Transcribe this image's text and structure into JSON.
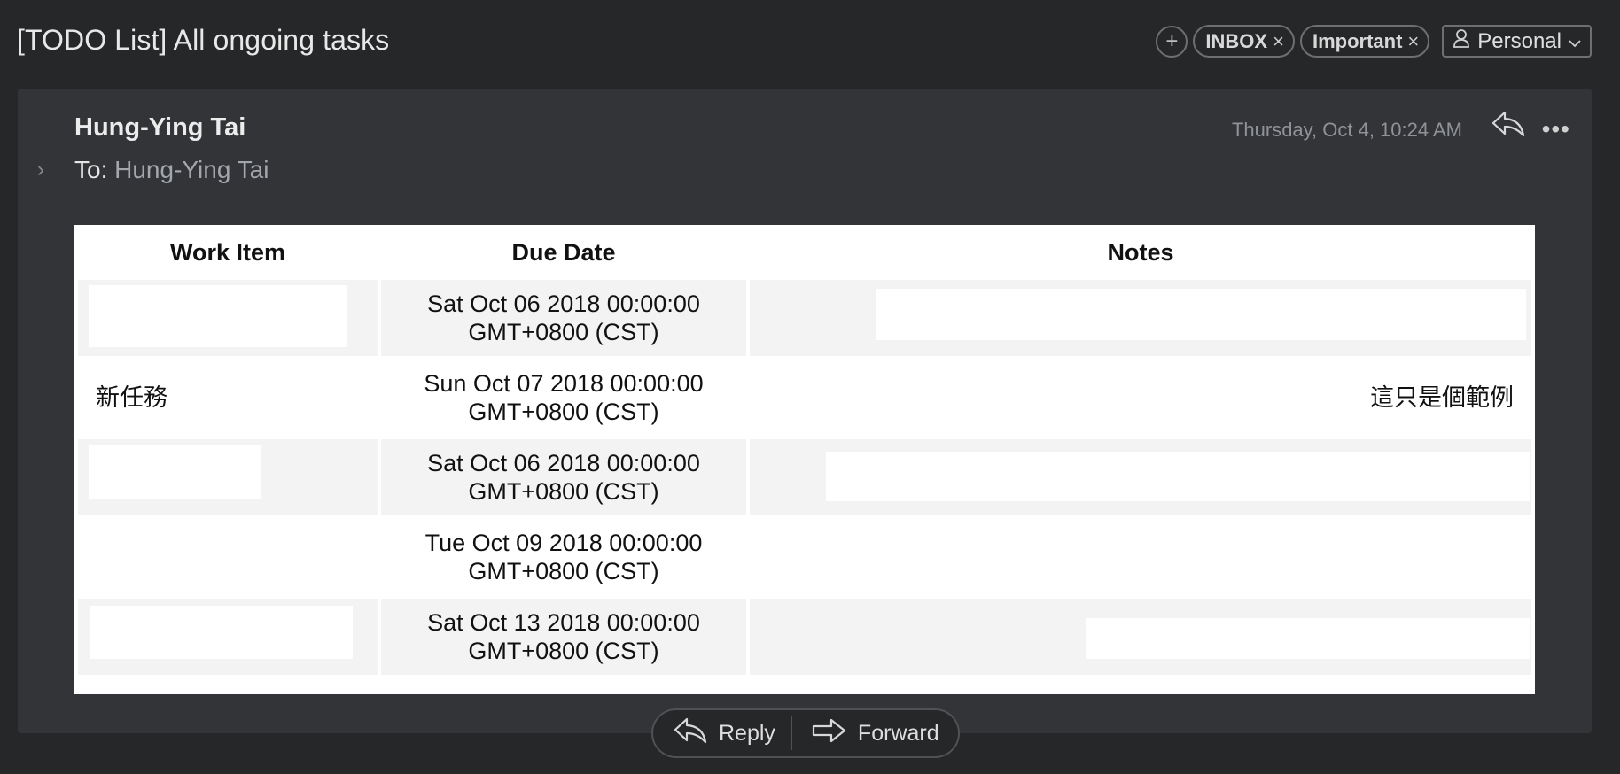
{
  "header": {
    "subject": "[TODO List] All ongoing tasks",
    "add_icon": "plus-icon",
    "tags": [
      {
        "label": "INBOX",
        "remove": "×"
      },
      {
        "label": "Important",
        "remove": "×"
      }
    ],
    "account": {
      "label": "Personal",
      "icon": "person-icon",
      "chevron": "chevron-down-icon"
    }
  },
  "message": {
    "sender": "Hung-Ying Tai",
    "to_label": "To:",
    "to_name": "Hung-Ying Tai",
    "date": "Thursday, Oct 4, 10:24 AM",
    "reply_icon": "reply-icon",
    "more_icon": "more-icon"
  },
  "table": {
    "headers": [
      "Work Item",
      "Due Date",
      "Notes"
    ],
    "rows": [
      {
        "work": "",
        "due_line1": "Sat Oct 06 2018 00:00:00",
        "due_line2": "GMT+0800 (CST)",
        "notes": ""
      },
      {
        "work": "新任務",
        "due_line1": "Sun Oct 07 2018 00:00:00",
        "due_line2": "GMT+0800 (CST)",
        "notes": "這只是個範例"
      },
      {
        "work": "",
        "due_line1": "Sat Oct 06 2018 00:00:00",
        "due_line2": "GMT+0800 (CST)",
        "notes": ""
      },
      {
        "work": "",
        "due_line1": "Tue Oct 09 2018 00:00:00",
        "due_line2": "GMT+0800 (CST)",
        "notes": ""
      },
      {
        "work": "",
        "due_line1": "Sat Oct 13 2018 00:00:00",
        "due_line2": "GMT+0800 (CST)",
        "notes": ""
      }
    ]
  },
  "actions": {
    "reply_label": "Reply",
    "forward_label": "Forward"
  }
}
